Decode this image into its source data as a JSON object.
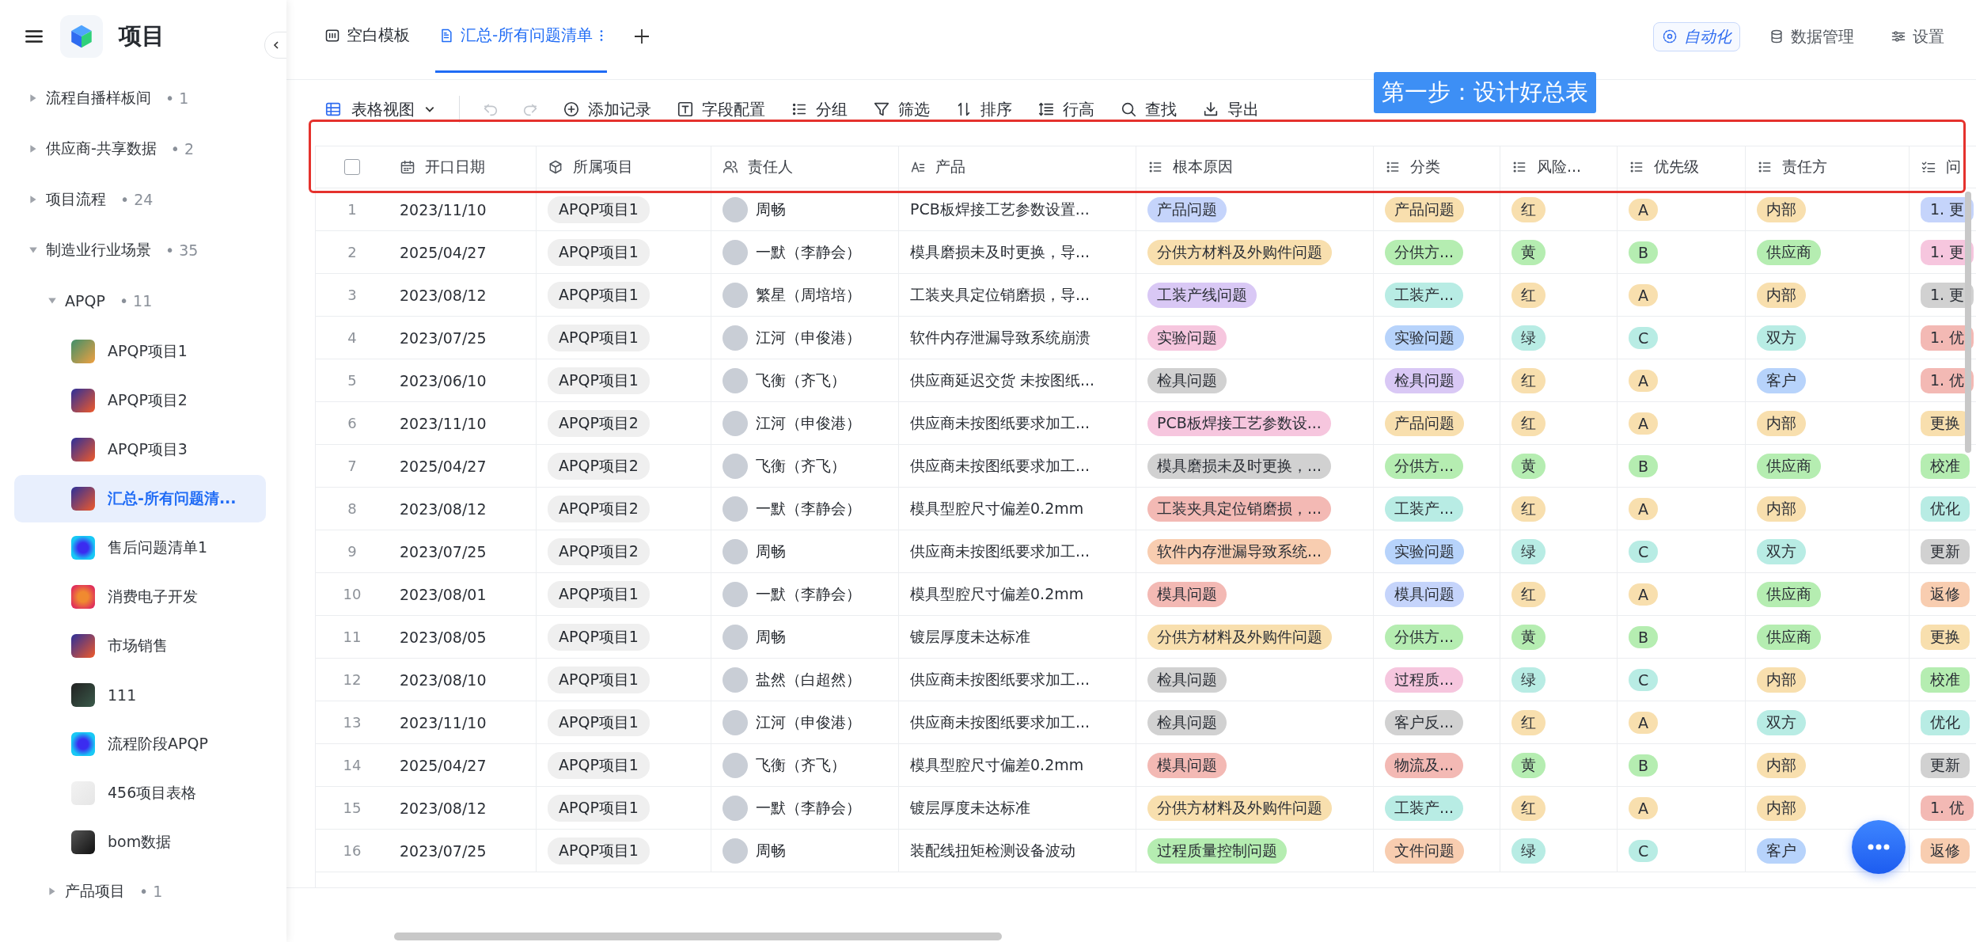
{
  "sidebar": {
    "title": "项目",
    "tree": [
      {
        "kind": "group",
        "label": "流程自播样板间",
        "count": "• 1",
        "expanded": false
      },
      {
        "kind": "group",
        "label": "供应商-共享数据",
        "count": "• 2",
        "expanded": false
      },
      {
        "kind": "group",
        "label": "项目流程",
        "count": "• 24",
        "expanded": false
      },
      {
        "kind": "group",
        "label": "制造业行业场景",
        "count": "• 35",
        "expanded": true,
        "children": [
          {
            "kind": "group",
            "label": "APQP",
            "count": "• 11",
            "expanded": true,
            "children": [
              {
                "kind": "table",
                "label": "APQP项目1",
                "selected": false
              },
              {
                "kind": "table",
                "label": "APQP项目2",
                "selected": false
              },
              {
                "kind": "table",
                "label": "APQP项目3",
                "selected": false
              },
              {
                "kind": "table",
                "label": "汇总-所有问题清...",
                "selected": true
              },
              {
                "kind": "table",
                "label": "售后问题清单1",
                "selected": false
              },
              {
                "kind": "table",
                "label": "消费电子开发",
                "selected": false
              },
              {
                "kind": "table",
                "label": "市场销售",
                "selected": false
              },
              {
                "kind": "table",
                "label": "111",
                "selected": false
              },
              {
                "kind": "table",
                "label": "流程阶段APQP",
                "selected": false
              },
              {
                "kind": "table",
                "label": "456项目表格",
                "selected": false
              },
              {
                "kind": "table",
                "label": "bom数据",
                "selected": false
              }
            ]
          },
          {
            "kind": "group",
            "label": "产品项目",
            "count": "• 1",
            "expanded": false
          }
        ]
      }
    ]
  },
  "tabs": [
    {
      "kind": "template",
      "label": "空白模板",
      "selected": false
    },
    {
      "kind": "sheet",
      "label": "汇总-所有问题清单",
      "selected": true
    }
  ],
  "header_actions": [
    {
      "kind": "automation",
      "label": "自动化"
    },
    {
      "kind": "data",
      "label": "数据管理"
    },
    {
      "kind": "settings",
      "label": "设置"
    }
  ],
  "view": {
    "label": "表格视图"
  },
  "history": [
    {
      "kind": "undo",
      "disabled": true
    },
    {
      "kind": "redo",
      "disabled": true
    }
  ],
  "toolbar": [
    {
      "kind": "add",
      "label": "添加记录"
    },
    {
      "kind": "fields",
      "label": "字段配置"
    },
    {
      "kind": "group",
      "label": "分组"
    },
    {
      "kind": "filter",
      "label": "筛选"
    },
    {
      "kind": "sort",
      "label": "排序"
    },
    {
      "kind": "height",
      "label": "行高"
    },
    {
      "kind": "find",
      "label": "查找"
    },
    {
      "kind": "export",
      "label": "导出"
    }
  ],
  "annotation": {
    "text": "第一步：设计好总表"
  },
  "table": {
    "select_all": {
      "checked": false
    },
    "columns": [
      {
        "kind": "date",
        "label": "开口日期"
      },
      {
        "kind": "link",
        "label": "所属项目"
      },
      {
        "kind": "person",
        "label": "责任人"
      },
      {
        "kind": "text",
        "label": "产品"
      },
      {
        "kind": "select",
        "label": "根本原因"
      },
      {
        "kind": "select",
        "label": "分类"
      },
      {
        "kind": "select",
        "label": "风险..."
      },
      {
        "kind": "select",
        "label": "优先级"
      },
      {
        "kind": "select",
        "label": "责任方"
      },
      {
        "kind": "multi",
        "label": "问"
      }
    ],
    "rows": [
      {
        "num": "1",
        "cells": [
          "2023/11/10",
          "APQP项目1",
          "周畅",
          "PCB板焊接工艺参数设置...",
          {
            "text": "产品问题",
            "color": "#c5d4fb"
          },
          {
            "text": "产品问题",
            "color": "#f8dfae"
          },
          {
            "text": "红",
            "color": "#f8dfae"
          },
          {
            "text": "A",
            "color": "#f8dfae"
          },
          {
            "text": "内部",
            "color": "#f8dfae"
          },
          {
            "text": "1. 更",
            "color": "#c5d4fb"
          }
        ]
      },
      {
        "num": "2",
        "cells": [
          "2025/04/27",
          "APQP项目1",
          "一默（李静会）",
          "模具磨损未及时更换，导...",
          {
            "text": "分供方材料及外购件问题",
            "color": "#f8dfae"
          },
          {
            "text": "分供方...",
            "color": "#b5edb1"
          },
          {
            "text": "黄",
            "color": "#b5edb1"
          },
          {
            "text": "B",
            "color": "#b5edb1"
          },
          {
            "text": "供应商",
            "color": "#b5edb1"
          },
          {
            "text": "1. 更",
            "color": "#f6c6de"
          }
        ]
      },
      {
        "num": "3",
        "cells": [
          "2023/08/12",
          "APQP项目1",
          "繁星（周培培）",
          "工装夹具定位销磨损，导...",
          {
            "text": "工装产线问题",
            "color": "#d9c8f5"
          },
          {
            "text": "工装产...",
            "color": "#b8ece4"
          },
          {
            "text": "红",
            "color": "#f8dfae"
          },
          {
            "text": "A",
            "color": "#f8dfae"
          },
          {
            "text": "内部",
            "color": "#f8dfae"
          },
          {
            "text": "1. 更",
            "color": "#d1d1d1"
          }
        ]
      },
      {
        "num": "4",
        "cells": [
          "2023/07/25",
          "APQP项目1",
          "江河（申俊港）",
          "软件内存泄漏导致系统崩溃",
          {
            "text": "实验问题",
            "color": "#f6c6de"
          },
          {
            "text": "实验问题",
            "color": "#b7d3fb"
          },
          {
            "text": "绿",
            "color": "#b8ece4"
          },
          {
            "text": "C",
            "color": "#b8ece4"
          },
          {
            "text": "双方",
            "color": "#b8ece4"
          },
          {
            "text": "1. 优",
            "color": "#f3b9b4"
          }
        ]
      },
      {
        "num": "5",
        "cells": [
          "2023/06/10",
          "APQP项目1",
          "飞衡（齐飞）",
          "供应商延迟交货 未按图纸...",
          {
            "text": "检具问题",
            "color": "#d1d1d1"
          },
          {
            "text": "检具问题",
            "color": "#d9c8f5"
          },
          {
            "text": "红",
            "color": "#f8dfae"
          },
          {
            "text": "A",
            "color": "#f8dfae"
          },
          {
            "text": "客户",
            "color": "#b7d3fb"
          },
          {
            "text": "1. 优",
            "color": "#f3b9b4"
          }
        ]
      },
      {
        "num": "6",
        "cells": [
          "2023/11/10",
          "APQP项目2",
          "江河（申俊港）",
          "供应商未按图纸要求加工...",
          {
            "text": "PCB板焊接工艺参数设...",
            "color": "#f6c6de"
          },
          {
            "text": "产品问题",
            "color": "#f8dfae"
          },
          {
            "text": "红",
            "color": "#f8dfae"
          },
          {
            "text": "A",
            "color": "#f8dfae"
          },
          {
            "text": "内部",
            "color": "#f8dfae"
          },
          {
            "text": "更换",
            "color": "#f8dfae"
          }
        ]
      },
      {
        "num": "7",
        "cells": [
          "2025/04/27",
          "APQP项目2",
          "飞衡（齐飞）",
          "供应商未按图纸要求加工...",
          {
            "text": "模具磨损未及时更换，...",
            "color": "#d1d1d1"
          },
          {
            "text": "分供方...",
            "color": "#b5edb1"
          },
          {
            "text": "黄",
            "color": "#b5edb1"
          },
          {
            "text": "B",
            "color": "#b5edb1"
          },
          {
            "text": "供应商",
            "color": "#b5edb1"
          },
          {
            "text": "校准",
            "color": "#b5edb1"
          }
        ]
      },
      {
        "num": "8",
        "cells": [
          "2023/08/12",
          "APQP项目2",
          "一默（李静会）",
          "模具型腔尺寸偏差0.2mm",
          {
            "text": "工装夹具定位销磨损，...",
            "color": "#f3b9b4"
          },
          {
            "text": "工装产...",
            "color": "#b8ece4"
          },
          {
            "text": "红",
            "color": "#f8dfae"
          },
          {
            "text": "A",
            "color": "#f8dfae"
          },
          {
            "text": "内部",
            "color": "#f8dfae"
          },
          {
            "text": "优化",
            "color": "#b8ece4"
          }
        ]
      },
      {
        "num": "9",
        "cells": [
          "2023/07/25",
          "APQP项目2",
          "周畅",
          "供应商未按图纸要求加工...",
          {
            "text": "软件内存泄漏导致系统...",
            "color": "#f8cdb0"
          },
          {
            "text": "实验问题",
            "color": "#b7d3fb"
          },
          {
            "text": "绿",
            "color": "#b8ece4"
          },
          {
            "text": "C",
            "color": "#b8ece4"
          },
          {
            "text": "双方",
            "color": "#b8ece4"
          },
          {
            "text": "更新",
            "color": "#d1d1d1"
          }
        ]
      },
      {
        "num": "10",
        "cells": [
          "2023/08/01",
          "APQP项目1",
          "一默（李静会）",
          "模具型腔尺寸偏差0.2mm",
          {
            "text": "模具问题",
            "color": "#f3b9b4"
          },
          {
            "text": "模具问题",
            "color": "#c5d4fb"
          },
          {
            "text": "红",
            "color": "#f8dfae"
          },
          {
            "text": "A",
            "color": "#f8dfae"
          },
          {
            "text": "供应商",
            "color": "#b5edb1"
          },
          {
            "text": "返修",
            "color": "#f8cdb0"
          }
        ]
      },
      {
        "num": "11",
        "cells": [
          "2023/08/05",
          "APQP项目1",
          "周畅",
          "镀层厚度未达标准",
          {
            "text": "分供方材料及外购件问题",
            "color": "#f8dfae"
          },
          {
            "text": "分供方...",
            "color": "#b5edb1"
          },
          {
            "text": "黄",
            "color": "#b5edb1"
          },
          {
            "text": "B",
            "color": "#b5edb1"
          },
          {
            "text": "供应商",
            "color": "#b5edb1"
          },
          {
            "text": "更换",
            "color": "#f8dfae"
          }
        ]
      },
      {
        "num": "12",
        "cells": [
          "2023/08/10",
          "APQP项目1",
          "盐然（白超然）",
          "供应商未按图纸要求加工...",
          {
            "text": "检具问题",
            "color": "#d1d1d1"
          },
          {
            "text": "过程质...",
            "color": "#f6c6de"
          },
          {
            "text": "绿",
            "color": "#b8ece4"
          },
          {
            "text": "C",
            "color": "#b8ece4"
          },
          {
            "text": "内部",
            "color": "#f8dfae"
          },
          {
            "text": "校准",
            "color": "#b5edb1"
          }
        ]
      },
      {
        "num": "13",
        "cells": [
          "2023/11/10",
          "APQP项目1",
          "江河（申俊港）",
          "供应商未按图纸要求加工...",
          {
            "text": "检具问题",
            "color": "#d1d1d1"
          },
          {
            "text": "客户反...",
            "color": "#d1d1d1"
          },
          {
            "text": "红",
            "color": "#f8dfae"
          },
          {
            "text": "A",
            "color": "#f8dfae"
          },
          {
            "text": "双方",
            "color": "#b8ece4"
          },
          {
            "text": "优化",
            "color": "#b8ece4"
          }
        ]
      },
      {
        "num": "14",
        "cells": [
          "2025/04/27",
          "APQP项目1",
          "飞衡（齐飞）",
          "模具型腔尺寸偏差0.2mm",
          {
            "text": "模具问题",
            "color": "#f3b9b4"
          },
          {
            "text": "物流及...",
            "color": "#f3b9b4"
          },
          {
            "text": "黄",
            "color": "#b5edb1"
          },
          {
            "text": "B",
            "color": "#b5edb1"
          },
          {
            "text": "内部",
            "color": "#f8dfae"
          },
          {
            "text": "更新",
            "color": "#d1d1d1"
          }
        ]
      },
      {
        "num": "15",
        "cells": [
          "2023/08/12",
          "APQP项目1",
          "一默（李静会）",
          "镀层厚度未达标准",
          {
            "text": "分供方材料及外购件问题",
            "color": "#f8dfae"
          },
          {
            "text": "工装产...",
            "color": "#b8ece4"
          },
          {
            "text": "红",
            "color": "#f8dfae"
          },
          {
            "text": "A",
            "color": "#f8dfae"
          },
          {
            "text": "内部",
            "color": "#f8dfae"
          },
          {
            "text": "1. 优",
            "color": "#f3b9b4"
          }
        ]
      },
      {
        "num": "16",
        "cells": [
          "2023/07/25",
          "APQP项目1",
          "周畅",
          "装配线扭矩检测设备波动",
          {
            "text": "过程质量控制问题",
            "color": "#b5edb1"
          },
          {
            "text": "文件问题",
            "color": "#f8cdb0"
          },
          {
            "text": "绿",
            "color": "#b8ece4"
          },
          {
            "text": "C",
            "color": "#b8ece4"
          },
          {
            "text": "客户",
            "color": "#b7d3fb"
          },
          {
            "text": "返修",
            "color": "#f8cdb0"
          }
        ]
      }
    ]
  }
}
